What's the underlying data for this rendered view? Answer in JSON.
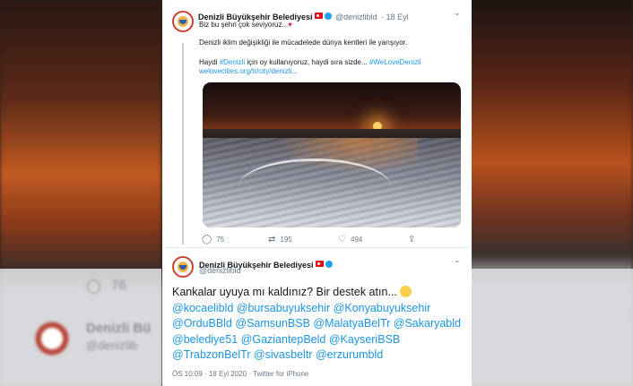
{
  "tweet1": {
    "name": "Denizli Büyükşehir Belediyesi",
    "handle": "@denizlibld",
    "date": "18 Eyl",
    "line1": "Biz bu şehri çok seviyoruz...",
    "line2": "Denizli iklim değişikliği ile mücadelede dünya kentleri ile yarışıyor.",
    "line3_a": "Haydi",
    "hashtag_denizli": "#Denizli",
    "line3_b": "için oy kullanıyoruz, haydi sıra sizde...",
    "hashtag_welove": "#WeLoveDenizli",
    "url": "welovecities.org/tr/city/denizli...",
    "replies": "75",
    "retweets": "195",
    "likes": "494"
  },
  "tweet2": {
    "name": "Denizli Büyükşehir Belediyesi",
    "handle": "@denizlibld",
    "text": "Kankalar uyuya mı kaldınız? Bir destek atın...",
    "mentions": [
      "@kocaelibld",
      "@bursabuyuksehir",
      "@Konyabuyuksehir",
      "@OrduBBld",
      "@SamsunBSB",
      "@MalatyaBelTr",
      "@Sakaryabld",
      "@belediye51",
      "@GaziantepBeld",
      "@KayseriBSB",
      "@TrabzonBelTr",
      "@sivasbeltr",
      "@erzurumbld"
    ],
    "time": "ÖS 10:09 · 18 Eyl 2020 · Twitter for iPhone"
  },
  "background": {
    "ghost_count": "76",
    "ghost_name": "Denizli Bü",
    "ghost_handle": "@denizlib"
  },
  "colors": {
    "link": "#1b95e0",
    "verified": "#1da1f2",
    "flag": "#e30a17"
  },
  "icons": [
    "reply-icon",
    "retweet-icon",
    "like-icon",
    "share-icon",
    "chevron-down-icon",
    "verified-icon",
    "turkish-flag-icon",
    "heart-emoji",
    "smile-emoji"
  ]
}
